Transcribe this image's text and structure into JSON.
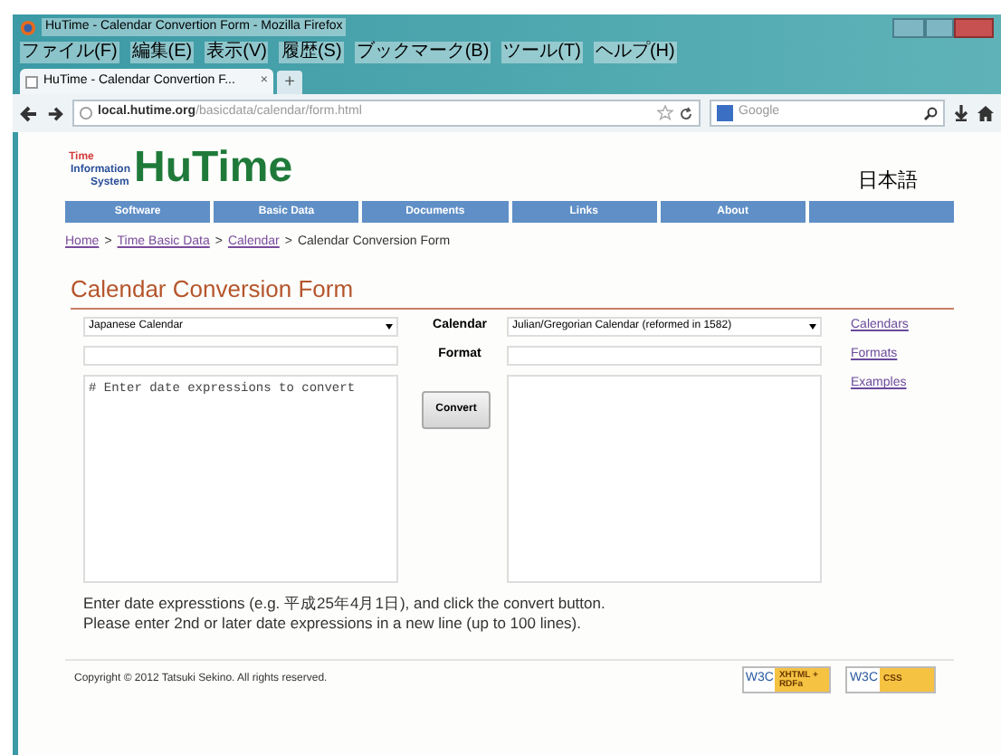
{
  "window": {
    "title": "HuTime - Calendar Convertion Form - Mozilla Firefox"
  },
  "menu": [
    "ファイル(F)",
    "編集(E)",
    "表示(V)",
    "履歴(S)",
    "ブックマーク(B)",
    "ツール(T)",
    "ヘルプ(H)"
  ],
  "tabs": [
    {
      "title": "HuTime - Calendar Convertion F...",
      "close": "×",
      "selected": true
    }
  ],
  "new_tab": "+",
  "address_bar": {
    "url_host": "local.hutime.org",
    "url_path": "/basicdata/calendar/form.html"
  },
  "search": {
    "placeholder": "Google"
  },
  "logo": {
    "lines": [
      "Time",
      "Information",
      "System"
    ],
    "name": "HuTime"
  },
  "language": "日本語",
  "nav": [
    "Software",
    "Basic Data",
    "Documents",
    "Links",
    "About"
  ],
  "breadcrumb": {
    "links": [
      "Home",
      "Time Basic Data",
      "Calendar"
    ],
    "separator": ">",
    "current": "Calendar Conversion Form"
  },
  "heading": "Calendar Conversion Form",
  "form": {
    "source_calendar": "Japanese Calendar",
    "calendar_label": "Calendar",
    "format_label": "Format",
    "target_calendar": "Julian/Gregorian Calendar (reformed in 1582)",
    "input_text": "# Enter date expressions to convert",
    "convert": "Convert"
  },
  "side_links": [
    "Calendars",
    "Formats",
    "Examples"
  ],
  "notes": [
    "Enter date expresstions (e.g. 平成25年4月1日), and click the convert button.",
    "Please enter 2nd or later date expressions in a new line (up to 100 lines)."
  ],
  "footer": {
    "copyright": "Copyright © 2012 Tatsuki Sekino. All rights reserved.",
    "badges": [
      {
        "mark": "W3C",
        "label": "XHTML + RDFa"
      },
      {
        "mark": "W3C",
        "label": "CSS"
      }
    ]
  }
}
